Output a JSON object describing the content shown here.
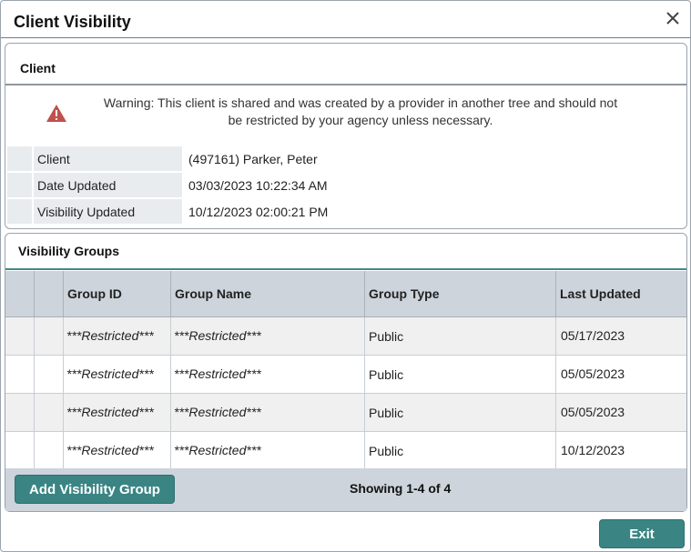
{
  "dialog": {
    "title": "Client Visibility",
    "close_icon": "close-icon"
  },
  "client_panel": {
    "title": "Client",
    "warning_icon": "warning-triangle-icon",
    "warning_color": "#c0504d",
    "warning_line1": "Warning: This client is shared and was created by a provider in another tree and should not",
    "warning_line2": "be restricted by your agency unless necessary.",
    "rows": [
      {
        "label": "Client",
        "value": "(497161) Parker, Peter"
      },
      {
        "label": "Date Updated",
        "value": "03/03/2023 10:22:34 AM"
      },
      {
        "label": "Visibility Updated",
        "value": "10/12/2023 02:00:21 PM"
      }
    ]
  },
  "groups_panel": {
    "title": "Visibility Groups",
    "columns": [
      "Group ID",
      "Group Name",
      "Group Type",
      "Last Updated"
    ],
    "rows": [
      {
        "group_id": "***Restricted***",
        "group_name": "***Restricted***",
        "group_type": "Public",
        "last_updated": "05/17/2023"
      },
      {
        "group_id": "***Restricted***",
        "group_name": "***Restricted***",
        "group_type": "Public",
        "last_updated": "05/05/2023"
      },
      {
        "group_id": "***Restricted***",
        "group_name": "***Restricted***",
        "group_type": "Public",
        "last_updated": "05/05/2023"
      },
      {
        "group_id": "***Restricted***",
        "group_name": "***Restricted***",
        "group_type": "Public",
        "last_updated": "10/12/2023"
      }
    ],
    "add_button_label": "Add Visibility Group",
    "showing_text": "Showing 1-4 of 4"
  },
  "footer": {
    "exit_label": "Exit"
  },
  "colors": {
    "accent": "#3a8584",
    "header_bg": "#cdd4dc"
  }
}
